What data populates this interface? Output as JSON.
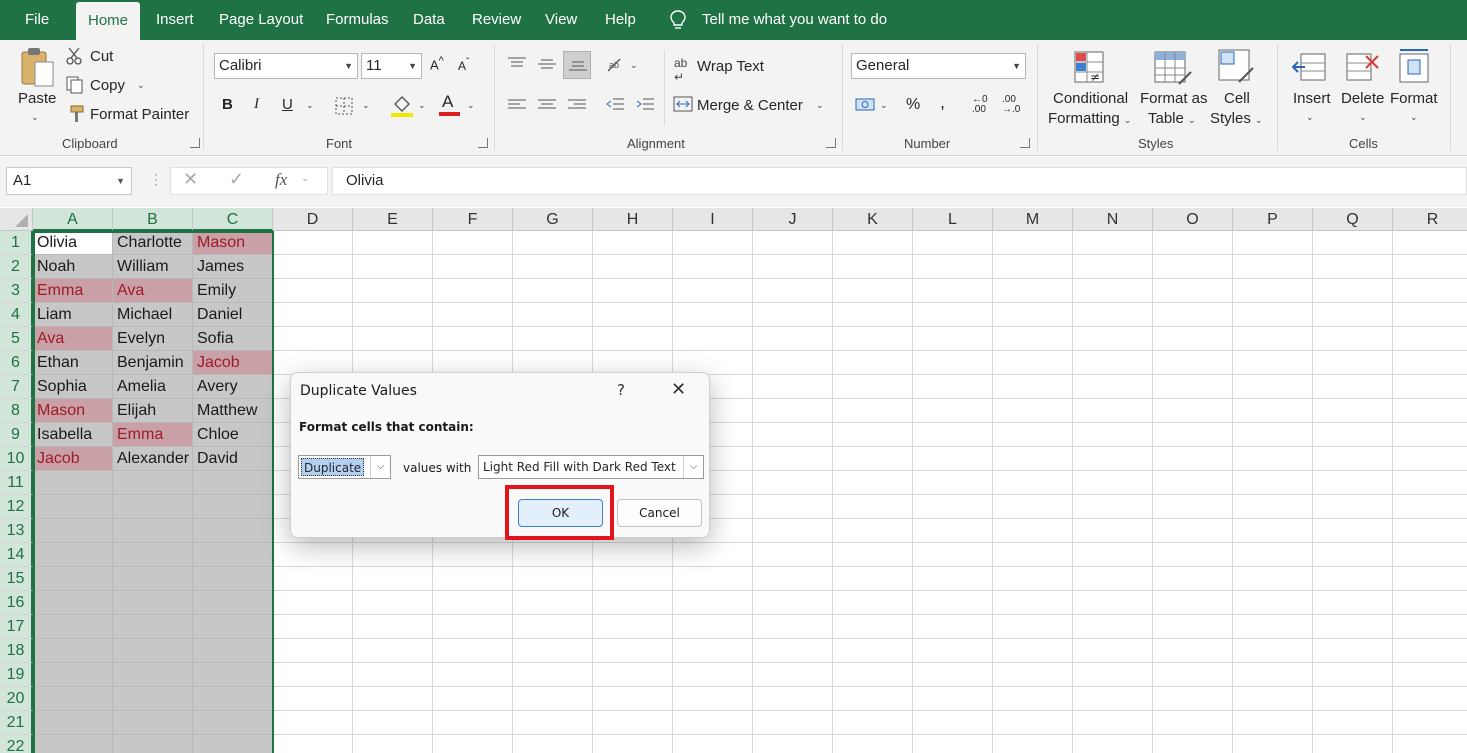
{
  "menu": {
    "tabs": [
      "File",
      "Home",
      "Insert",
      "Page Layout",
      "Formulas",
      "Data",
      "Review",
      "View",
      "Help"
    ],
    "active_tab": "Home",
    "tell_me": "Tell me what you want to do"
  },
  "ribbon": {
    "clipboard": {
      "paste": "Paste",
      "cut": "Cut",
      "copy": "Copy",
      "format_painter": "Format Painter",
      "label": "Clipboard"
    },
    "font": {
      "name": "Calibri",
      "size": "11",
      "bold": "B",
      "italic": "I",
      "underline": "U",
      "label": "Font",
      "font_color": "#e02020",
      "highlight_color": "#f3e600"
    },
    "alignment": {
      "wrap_text": "Wrap Text",
      "merge_center": "Merge & Center",
      "label": "Alignment"
    },
    "number": {
      "format": "General",
      "label": "Number",
      "percent": "%",
      "comma": ","
    },
    "styles": {
      "conditional_line1": "Conditional",
      "conditional_line2": "Formatting",
      "format_table_line1": "Format as",
      "format_table_line2": "Table",
      "cell_styles_line1": "Cell",
      "cell_styles_line2": "Styles",
      "label": "Styles"
    },
    "cells": {
      "insert": "Insert",
      "delete": "Delete",
      "format": "Format",
      "label": "Cells"
    }
  },
  "formula_bar": {
    "name_box": "A1",
    "fx": "fx",
    "content": "Olivia"
  },
  "sheet": {
    "columns": [
      "A",
      "B",
      "C",
      "D",
      "E",
      "F",
      "G",
      "H",
      "I",
      "J",
      "K",
      "L",
      "M",
      "N",
      "O",
      "P",
      "Q",
      "R"
    ],
    "rows": [
      "1",
      "2",
      "3",
      "4",
      "5",
      "6",
      "7",
      "8",
      "9",
      "10",
      "11",
      "12",
      "13",
      "14",
      "15",
      "16",
      "17",
      "18",
      "19",
      "20",
      "21",
      "22"
    ],
    "data": [
      [
        "Olivia",
        "Charlotte",
        "Mason"
      ],
      [
        "Noah",
        "William",
        "James"
      ],
      [
        "Emma",
        "Ava",
        "Emily"
      ],
      [
        "Liam",
        "Michael",
        "Daniel"
      ],
      [
        "Ava",
        "Evelyn",
        "Sofia"
      ],
      [
        "Ethan",
        "Benjamin",
        "Jacob"
      ],
      [
        "Sophia",
        "Amelia",
        "Avery"
      ],
      [
        "Mason",
        "Elijah",
        "Matthew"
      ],
      [
        "Isabella",
        "Emma",
        "Chloe"
      ],
      [
        "Jacob",
        "Alexander",
        "David"
      ]
    ],
    "duplicates": [
      [
        0,
        2
      ],
      [
        2,
        0
      ],
      [
        2,
        1
      ],
      [
        4,
        0
      ],
      [
        5,
        2
      ],
      [
        7,
        0
      ],
      [
        8,
        1
      ],
      [
        9,
        0
      ]
    ],
    "duplicate_fill": "#c9a0a5",
    "duplicate_text": "#9c1c2a"
  },
  "dialog": {
    "title": "Duplicate Values",
    "help": "?",
    "close": "✕",
    "prompt": "Format cells that contain:",
    "type_value": "Duplicate",
    "values_with": "values with",
    "format_value": "Light Red Fill with Dark Red Text",
    "ok": "OK",
    "cancel": "Cancel"
  }
}
